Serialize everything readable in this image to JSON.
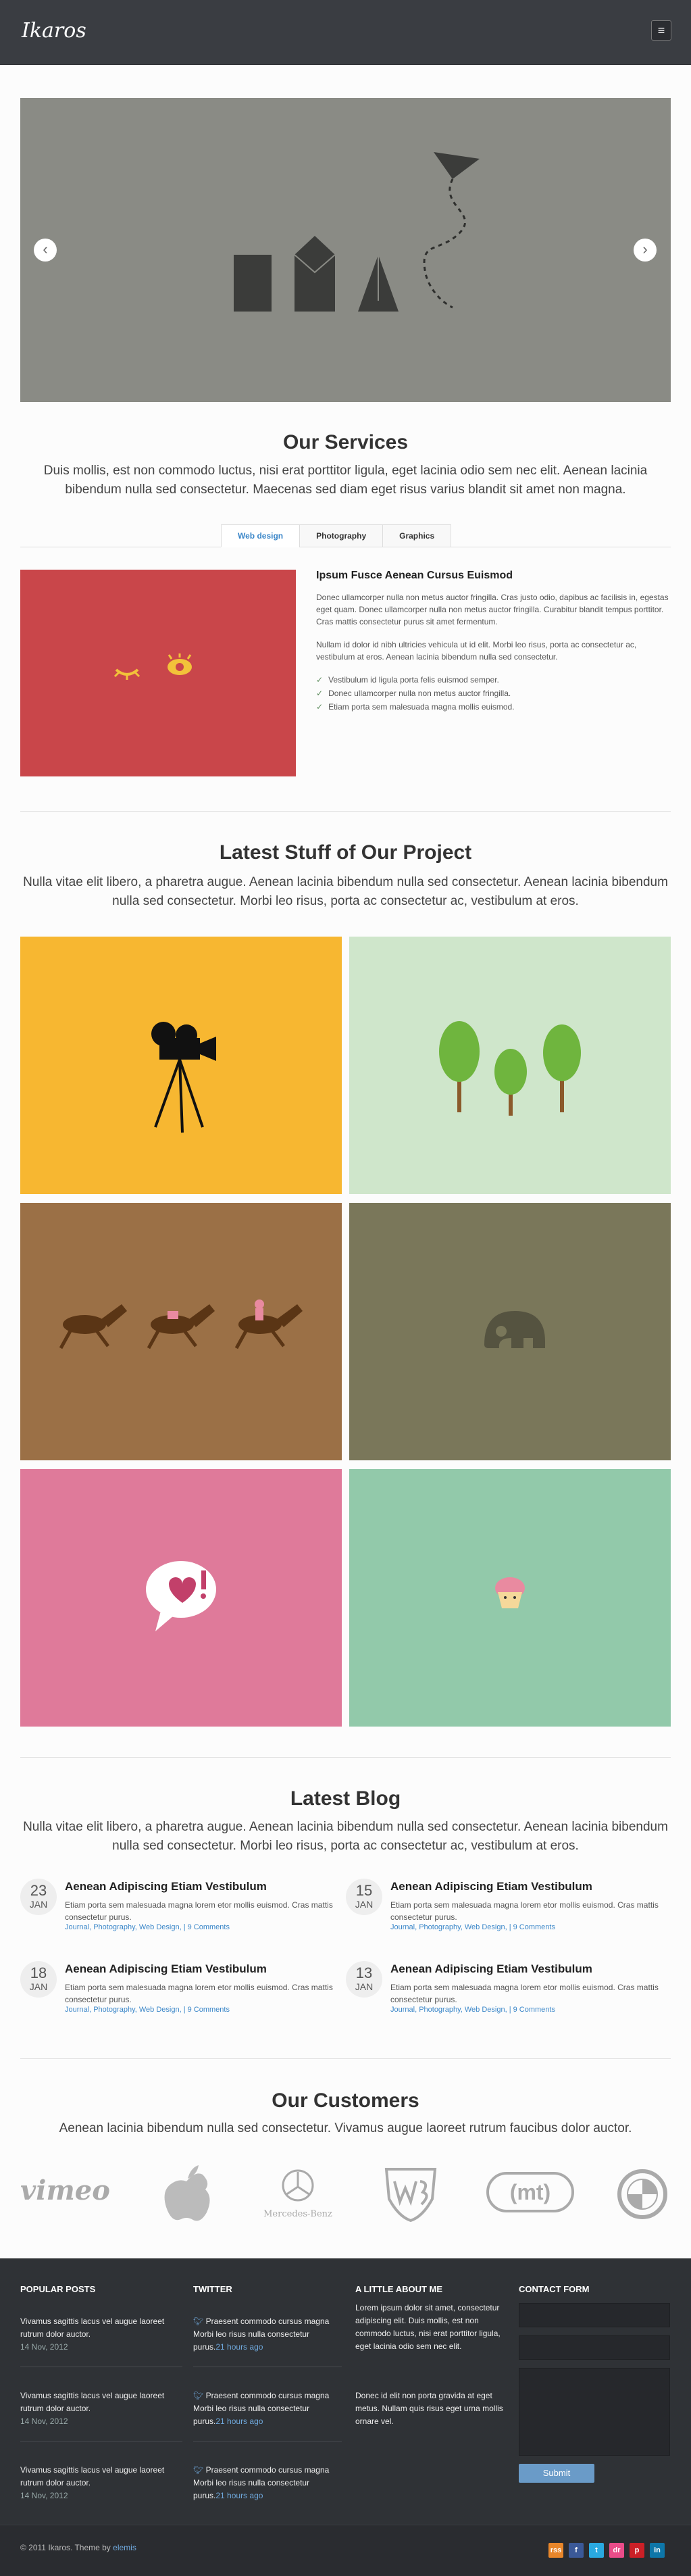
{
  "header": {
    "logo": "Ikaros",
    "menu_icon": "hamburger-icon",
    "menu_glyph": "≡"
  },
  "slider": {
    "prev": "‹",
    "next": "›"
  },
  "services": {
    "title": "Our Services",
    "subtitle": "Duis mollis, est non commodo luctus, nisi erat porttitor ligula, eget lacinia odio sem nec elit. Aenean lacinia bibendum nulla sed consectetur. Maecenas sed diam eget risus varius blandit sit amet non magna.",
    "tabs": [
      "Web design",
      "Photography",
      "Graphics"
    ],
    "heading": "Ipsum Fusce Aenean Cursus Euismod",
    "p1": "Donec ullamcorper nulla non metus auctor fringilla. Cras justo odio, dapibus ac facilisis in, egestas eget quam. Donec ullamcorper nulla non metus auctor fringilla. Curabitur blandit tempus porttitor. Cras mattis consectetur purus sit amet fermentum.",
    "p2": "Nullam id dolor id nibh ultricies vehicula ut id elit. Morbi leo risus, porta ac consectetur ac, vestibulum at eros. Aenean lacinia bibendum nulla sed consectetur.",
    "list": [
      "Vestibulum id ligula porta felis euismod semper.",
      "Donec ullamcorper nulla non metus auctor fringilla.",
      "Etiam porta sem malesuada magna mollis euismod."
    ],
    "check": "✓"
  },
  "projects": {
    "title": "Latest Stuff of Our Project",
    "subtitle": "Nulla vitae elit libero, a pharetra augue. Aenean lacinia bibendum nulla sed consectetur. Aenean lacinia bibendum nulla sed consectetur. Morbi leo risus, porta ac consectetur ac, vestibulum at eros.",
    "tile_colors": [
      "#f7b731",
      "#cfe6cb",
      "#9b7046",
      "#7a775a",
      "#df7a9a",
      "#92c9aa"
    ]
  },
  "blog": {
    "title": "Latest Blog",
    "subtitle": "Nulla vitae elit libero, a pharetra augue. Aenean lacinia bibendum nulla sed consectetur. Aenean lacinia bibendum nulla sed consectetur. Morbi leo risus, porta ac consectetur ac, vestibulum at eros.",
    "posts": [
      {
        "day": "23",
        "month": "JAN",
        "title": "Aenean Adipiscing Etiam Vestibulum",
        "text": "Etiam porta sem malesuada magna lorem etor mollis euismod. Cras mattis consectetur purus.",
        "meta": "Journal, Photography, Web Design, | 9 Comments"
      },
      {
        "day": "15",
        "month": "JAN",
        "title": "Aenean Adipiscing Etiam Vestibulum",
        "text": "Etiam porta sem malesuada magna lorem etor mollis euismod. Cras mattis consectetur purus.",
        "meta": "Journal, Photography, Web Design, | 9 Comments"
      },
      {
        "day": "18",
        "month": "JAN",
        "title": "Aenean Adipiscing Etiam Vestibulum",
        "text": "Etiam porta sem malesuada magna lorem etor mollis euismod. Cras mattis consectetur purus.",
        "meta": "Journal, Photography, Web Design, | 9 Comments"
      },
      {
        "day": "13",
        "month": "JAN",
        "title": "Aenean Adipiscing Etiam Vestibulum",
        "text": "Etiam porta sem malesuada magna lorem etor mollis euismod. Cras mattis consectetur purus.",
        "meta": "Journal, Photography, Web Design, | 9 Comments"
      }
    ]
  },
  "customers": {
    "title": "Our Customers",
    "subtitle": "Aenean lacinia bibendum nulla sed consectetur. Vivamus augue laoreet rutrum faucibus dolor auctor.",
    "logos": [
      "vimeo",
      "Mercedes-Benz",
      "(mt)"
    ]
  },
  "footer": {
    "popular_title": "POPULAR POSTS",
    "popular": [
      {
        "text": "Vivamus sagittis lacus vel augue laoreet rutrum dolor auctor.",
        "date": "14 Nov, 2012"
      },
      {
        "text": "Vivamus sagittis lacus vel augue laoreet rutrum dolor auctor.",
        "date": "14 Nov, 2012"
      },
      {
        "text": "Vivamus sagittis lacus vel augue laoreet rutrum dolor auctor.",
        "date": "14 Nov, 2012"
      }
    ],
    "twitter_title": "TWITTER",
    "tweets": [
      {
        "text": "Praesent commodo cursus magna Morbi leo risus nulla consectetur purus.",
        "time": "21 hours ago"
      },
      {
        "text": "Praesent commodo cursus magna Morbi leo risus nulla consectetur purus.",
        "time": "21 hours ago"
      },
      {
        "text": "Praesent commodo cursus magna Morbi leo risus nulla consectetur purus.",
        "time": "21 hours ago"
      }
    ],
    "about_title": "A LITTLE ABOUT ME",
    "about1": "Lorem ipsum dolor sit amet, consectetur adipiscing elit. Duis mollis, est non commodo luctus, nisi erat porttitor ligula, eget lacinia odio sem nec elit.",
    "about2": "Donec id elit non porta gravida at eget metus. Nullam quis risus eget urna mollis ornare vel.",
    "contact_title": "CONTACT FORM",
    "submit": "Submit"
  },
  "bottom": {
    "copyright": "© 2011 Ikaros. Theme by ",
    "author": "elemis",
    "social": [
      "rss",
      "f",
      "t",
      "dr",
      "p",
      "in"
    ],
    "social_colors": [
      "#e8862a",
      "#3b5998",
      "#2aa9e0",
      "#ea4c89",
      "#cb2027",
      "#0e76a8"
    ]
  }
}
